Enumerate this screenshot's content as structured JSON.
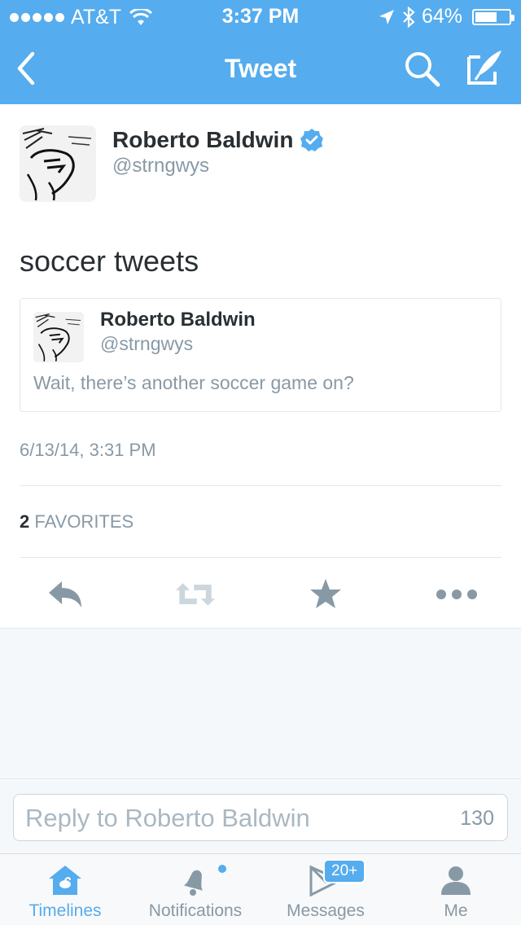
{
  "status_bar": {
    "carrier": "AT&T",
    "time": "3:37 PM",
    "battery": "64%",
    "battery_level": 0.64
  },
  "nav": {
    "title": "Tweet",
    "back_icon": "chevron-left-icon",
    "search_icon": "search-icon",
    "compose_icon": "compose-icon"
  },
  "tweet": {
    "author_name": "Roberto Baldwin",
    "author_handle": "@strngwys",
    "verified": true,
    "text": "soccer tweets",
    "quoted": {
      "author_name": "Roberto Baldwin",
      "author_handle": "@strngwys",
      "text": "Wait, there’s another soccer game on?"
    },
    "timestamp": "6/13/14, 3:31 PM",
    "favorites_count": "2",
    "favorites_label": "FAVORITES"
  },
  "actions": [
    "reply-icon",
    "retweet-icon",
    "star-icon",
    "more-icon"
  ],
  "reply": {
    "placeholder": "Reply to Roberto Baldwin",
    "char_count": "130"
  },
  "tabbar": {
    "tabs": [
      {
        "label": "Timelines",
        "icon": "home-icon",
        "active": true
      },
      {
        "label": "Notifications",
        "icon": "bell-icon",
        "active": false
      },
      {
        "label": "Messages",
        "icon": "messages-icon",
        "active": false
      },
      {
        "label": "Me",
        "icon": "person-icon",
        "active": false
      }
    ],
    "messages_badge": "20+"
  },
  "colors": {
    "brand": "#55acee",
    "text": "#292f33",
    "secondary_text": "#8899a6",
    "action_icon": "#8899a6"
  }
}
